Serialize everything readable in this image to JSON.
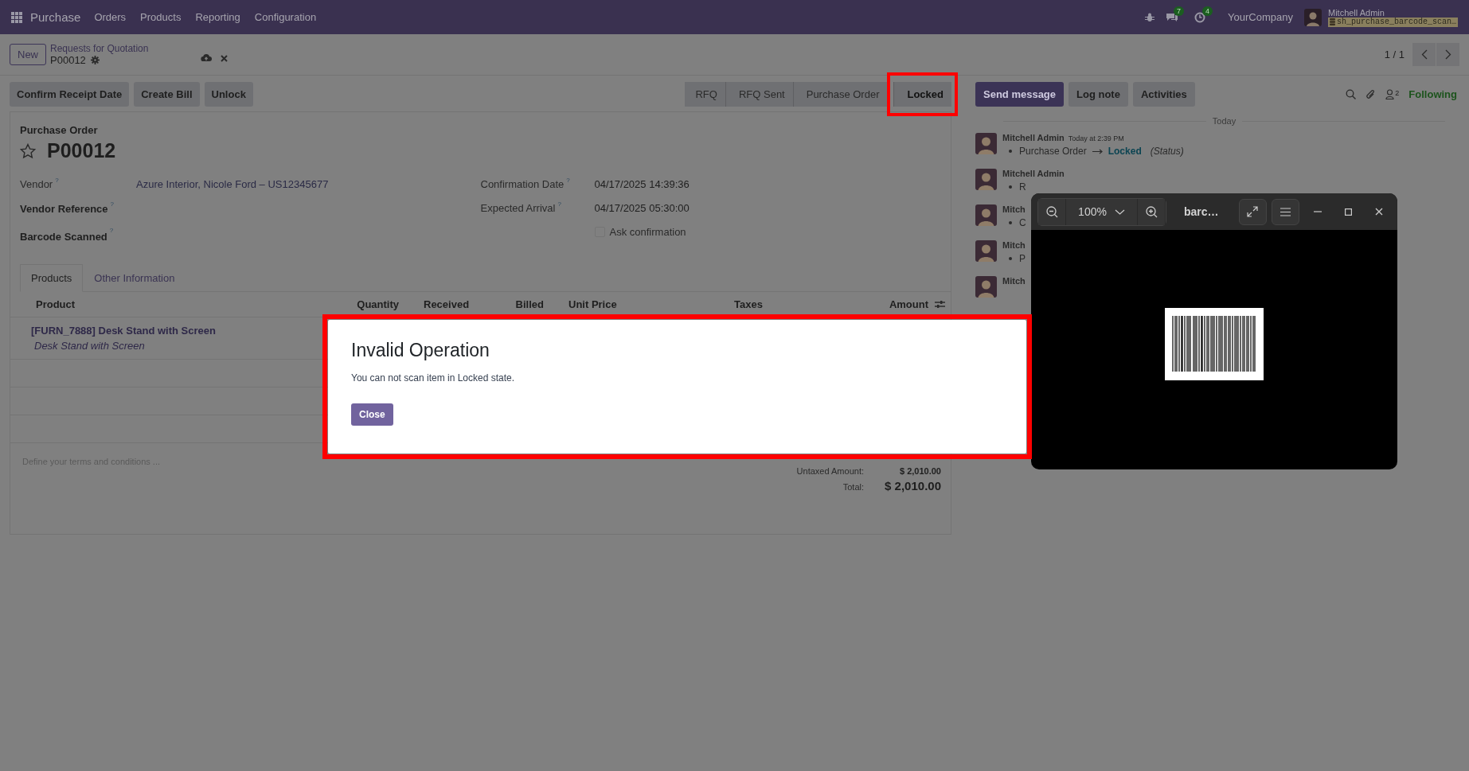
{
  "navbar": {
    "app": "Purchase",
    "menu": [
      "Orders",
      "Products",
      "Reporting",
      "Configuration"
    ],
    "messages_count": "7",
    "activities_count": "4",
    "company": "YourCompany",
    "user": "Mitchell Admin",
    "database": "sh_purchase_barcode_scan…"
  },
  "breadcrumb": {
    "new_button": "New",
    "parent": "Requests for Quotation",
    "current": "P00012"
  },
  "pager": "1 / 1",
  "actions": [
    "Confirm Receipt Date",
    "Create Bill",
    "Unlock"
  ],
  "stages": [
    {
      "label": "RFQ",
      "selected": false,
      "highlighted": false
    },
    {
      "label": "RFQ Sent",
      "selected": false,
      "highlighted": false
    },
    {
      "label": "Purchase Order",
      "selected": false,
      "highlighted": false
    },
    {
      "label": "Locked",
      "selected": true,
      "highlighted": true
    }
  ],
  "chatter_buttons": [
    {
      "label": "Send message",
      "kind": "primary"
    },
    {
      "label": "Log note",
      "kind": "secondary"
    },
    {
      "label": "Activities",
      "kind": "secondary"
    }
  ],
  "followers_count": "2",
  "follow_status": "Following",
  "form": {
    "type_label": "Purchase Order",
    "title": "P00012",
    "starred": false,
    "fields_left": [
      {
        "label": "Vendor",
        "help": "?",
        "value": "Azure Interior, Nicole Ford – US12345677",
        "bold": false
      },
      {
        "label": "Vendor Reference",
        "help": "?",
        "bold": true
      },
      {
        "label": "Barcode Scanned",
        "help": "?",
        "bold": true
      }
    ],
    "fields_right": [
      {
        "label": "Confirmation Date",
        "help": "?",
        "value": "04/17/2025 14:39:36"
      },
      {
        "label": "Expected Arrival",
        "help": "?",
        "value": "04/17/2025 05:30:00"
      }
    ],
    "ask_confirmation": {
      "label": "Ask confirmation",
      "checked": false
    },
    "tabs": [
      {
        "label": "Products",
        "selected": true
      },
      {
        "label": "Other Information",
        "selected": false
      }
    ],
    "columns": [
      "Product",
      "Quantity",
      "Received",
      "Billed",
      "Unit Price",
      "Taxes",
      "Amount"
    ],
    "rows": [
      {
        "product": "[FURN_7888] Desk Stand with Screen",
        "description": "Desk Stand with Screen"
      }
    ],
    "terms_placeholder": "Define your terms and conditions ...",
    "totals": [
      {
        "label": "Untaxed Amount:",
        "value": "$ 2,010.00",
        "kind": "subtotal"
      },
      {
        "label": "Total:",
        "value": "$ 2,010.00",
        "kind": "total"
      }
    ]
  },
  "chatter": {
    "day": "Today",
    "messages": [
      {
        "author": "Mitchell Admin",
        "time": "Today at 2:39 PM",
        "field": "Purchase Order",
        "new_value": "Locked",
        "field_name": "(Status)"
      },
      {
        "author": "Mitchell Admin",
        "line": "R"
      },
      {
        "author": "Mitch",
        "line": "C"
      },
      {
        "author": "Mitch",
        "line": "P"
      },
      {
        "author": "Mitch"
      }
    ]
  },
  "dialog": {
    "title": "Invalid Operation",
    "body": "You can not scan item in Locked state.",
    "button": "Close",
    "highlighted": true
  },
  "viewer": {
    "zoom": "100%",
    "title": "barc…"
  }
}
